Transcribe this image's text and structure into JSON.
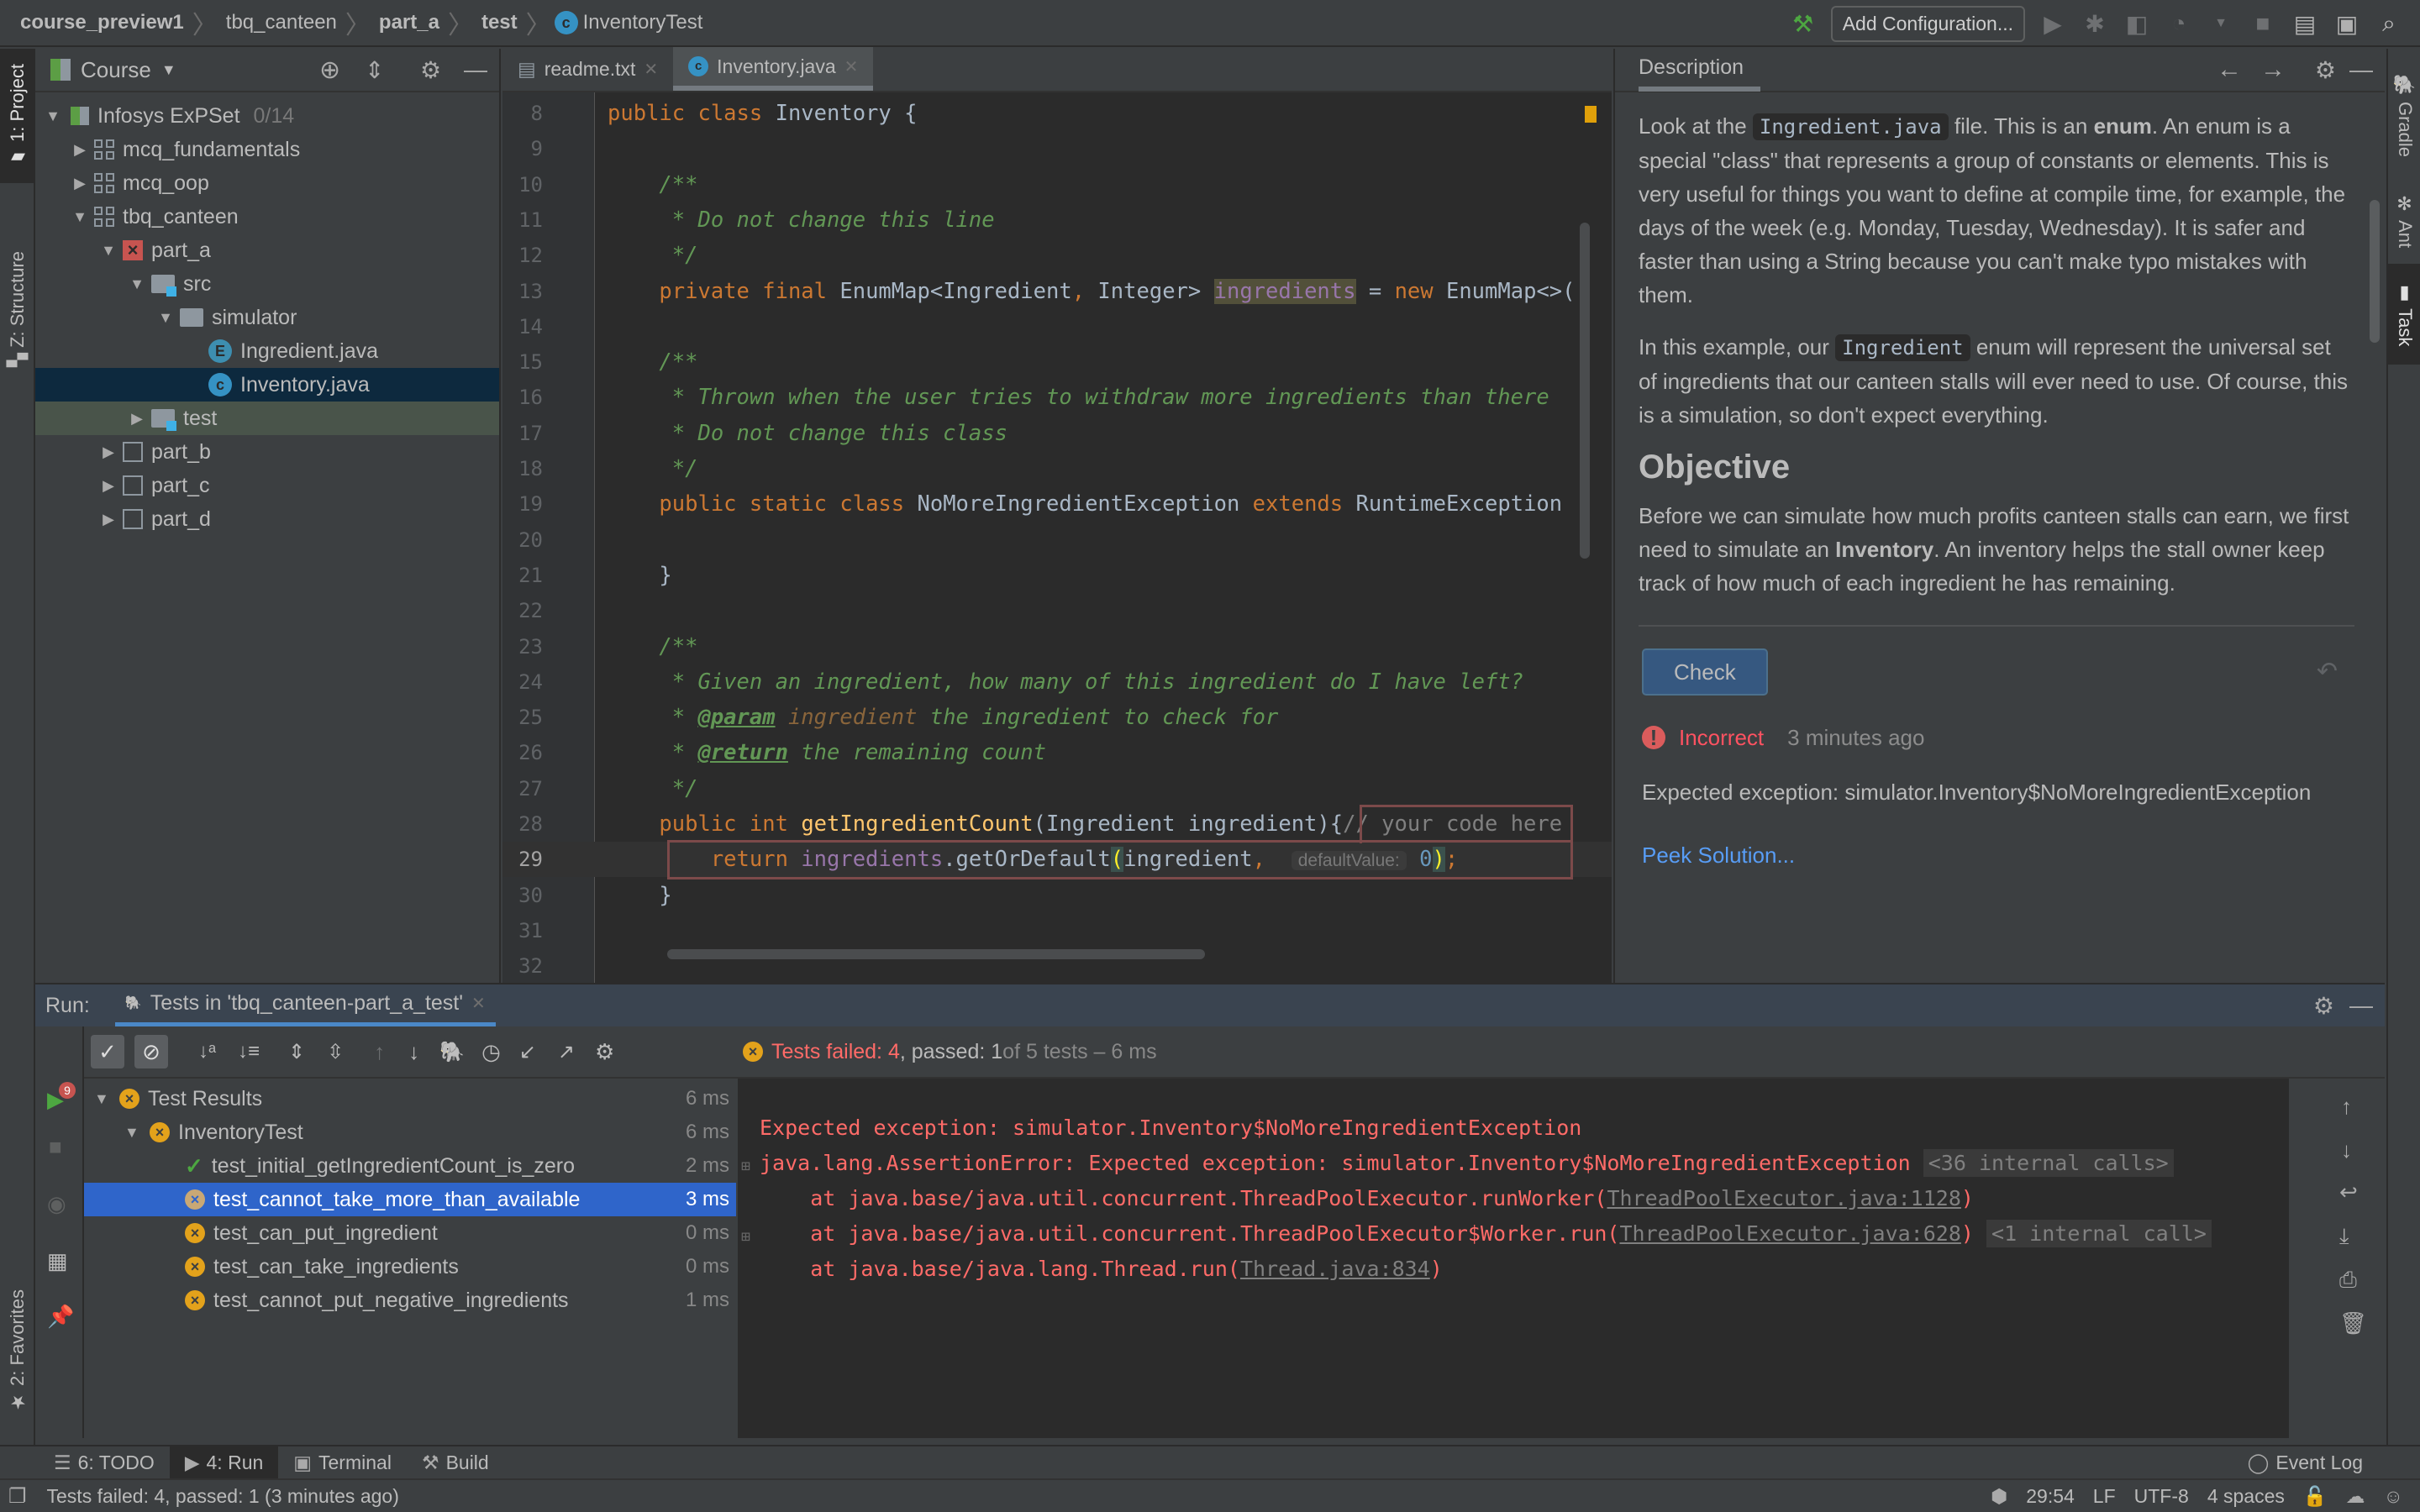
{
  "navbar": {
    "breadcrumbs": [
      "course_preview1",
      "tbq_canteen",
      "part_a",
      "test",
      "InventoryTest"
    ],
    "add_configuration": "Add Configuration..."
  },
  "left_strip": {
    "project": "1: Project",
    "structure": "Z: Structure",
    "favorites": "2: Favorites"
  },
  "right_strip": {
    "gradle": "Gradle",
    "ant": "Ant",
    "task": "Task"
  },
  "project_panel": {
    "title": "Course",
    "tree": [
      {
        "label": "Infosys ExPSet",
        "progress": "0/14",
        "level": 0,
        "expanded": true,
        "icon": "course-book"
      },
      {
        "label": "mcq_fundamentals",
        "level": 1,
        "expanded": false,
        "icon": "module-grid"
      },
      {
        "label": "mcq_oop",
        "level": 1,
        "expanded": false,
        "icon": "module-grid"
      },
      {
        "label": "tbq_canteen",
        "level": 1,
        "expanded": true,
        "icon": "module-grid"
      },
      {
        "label": "part_a",
        "level": 2,
        "expanded": true,
        "icon": "task-failed"
      },
      {
        "label": "src",
        "level": 3,
        "expanded": true,
        "icon": "source-folder"
      },
      {
        "label": "simulator",
        "level": 4,
        "expanded": true,
        "icon": "package-folder"
      },
      {
        "label": "Ingredient.java",
        "level": 5,
        "icon": "enum-file"
      },
      {
        "label": "Inventory.java",
        "level": 5,
        "icon": "class-file",
        "selected": true
      },
      {
        "label": "test",
        "level": 3,
        "expanded": false,
        "icon": "test-folder",
        "highlighted": true
      },
      {
        "label": "part_b",
        "level": 2,
        "expanded": false,
        "icon": "task-unchecked"
      },
      {
        "label": "part_c",
        "level": 2,
        "expanded": false,
        "icon": "task-unchecked"
      },
      {
        "label": "part_d",
        "level": 2,
        "expanded": false,
        "icon": "task-unchecked"
      }
    ]
  },
  "editor": {
    "tabs": [
      {
        "label": "readme.txt",
        "active": false
      },
      {
        "label": "Inventory.java",
        "active": true
      }
    ],
    "current_line": 29,
    "lines": [
      {
        "n": 8,
        "text": "public class Inventory {"
      },
      {
        "n": 9,
        "text": ""
      },
      {
        "n": 10,
        "text": "    /**"
      },
      {
        "n": 11,
        "text": "     * Do not change this line"
      },
      {
        "n": 12,
        "text": "     */"
      },
      {
        "n": 13,
        "text": "    private final EnumMap<Ingredient, Integer> ingredients = new EnumMap<>("
      },
      {
        "n": 14,
        "text": ""
      },
      {
        "n": 15,
        "text": "    /**"
      },
      {
        "n": 16,
        "text": "     * Thrown when the user tries to withdraw more ingredients than there"
      },
      {
        "n": 17,
        "text": "     * Do not change this class"
      },
      {
        "n": 18,
        "text": "     */"
      },
      {
        "n": 19,
        "text": "    public static class NoMoreIngredientException extends RuntimeException"
      },
      {
        "n": 20,
        "text": ""
      },
      {
        "n": 21,
        "text": "    }"
      },
      {
        "n": 22,
        "text": ""
      },
      {
        "n": 23,
        "text": "    /**"
      },
      {
        "n": 24,
        "text": "     * Given an ingredient, how many of this ingredient do I have left?"
      },
      {
        "n": 25,
        "text": "     * @param ingredient the ingredient to check for"
      },
      {
        "n": 26,
        "text": "     * @return the remaining count"
      },
      {
        "n": 27,
        "text": "     */"
      },
      {
        "n": 28,
        "text": "    public int getIngredientCount(Ingredient ingredient){// your code here"
      },
      {
        "n": 29,
        "text": "        return ingredients.getOrDefault(ingredient,  defaultValue: 0);"
      },
      {
        "n": 30,
        "text": "    }"
      },
      {
        "n": 31,
        "text": ""
      },
      {
        "n": 32,
        "text": ""
      }
    ],
    "tokens": {
      "l8": [
        "public",
        "class",
        "Inventory {"
      ],
      "l10": "/**",
      "l11": "* Do not change this line",
      "l12": "*/",
      "l13": [
        "private",
        "final",
        "EnumMap<Ingredient",
        ",",
        " Integer> ",
        "ingredients",
        " = ",
        "new",
        " EnumMap<>("
      ],
      "l15": "/**",
      "l16": "* Thrown when the user tries to withdraw more ingredients than there",
      "l17": "* Do not change this class",
      "l18": "*/",
      "l19": [
        "public",
        "static",
        "class",
        "NoMoreIngredientException",
        "extends",
        "RuntimeException"
      ],
      "l21": "}",
      "l23": "/**",
      "l24": "* Given an ingredient, how many of this ingredient do I have left?",
      "l25": [
        "* ",
        "@param",
        "ingredient",
        "the ingredient to check for"
      ],
      "l26": [
        "* ",
        "@return",
        "the remaining count"
      ],
      "l27": "*/",
      "l28": [
        "public",
        "int",
        "getIngredientCount",
        "(Ingredient ingredient){",
        "// your code here"
      ],
      "l29": [
        "return",
        "ingredients",
        ".getOrDefault",
        "(",
        "ingredient",
        ",",
        "defaultValue:",
        "0",
        ")",
        ";"
      ],
      "l30": "}"
    }
  },
  "description": {
    "tab": "Description",
    "p1_parts": [
      "Look at the ",
      "Ingredient.java",
      " file. This is an ",
      "enum",
      ". An enum is a special \"class\" that represents a group of constants or elements. This is very useful for things you want to define at compile time, for example, the days of the week (e.g. Monday, Tuesday, Wednesday). It is safer and faster than using a String because you can't make typo mistakes with them."
    ],
    "p2_parts": [
      "In this example, our ",
      "Ingredient",
      " enum will represent the universal set of ingredients that our canteen stalls will ever need to use. Of course, this is a simulation, so don't expect everything."
    ],
    "objective_heading": "Objective",
    "p3_parts": [
      "Before we can simulate how much profits canteen stalls can earn, we first need to simulate an ",
      "Inventory",
      ". An inventory helps the stall owner keep track of how much of each ingredient he has remaining."
    ],
    "check_button": "Check",
    "result_status": "Incorrect",
    "result_time": "3 minutes ago",
    "result_message": "Expected exception: simulator.Inventory$NoMoreIngredientException",
    "peek_solution": "Peek Solution..."
  },
  "run_panel": {
    "label": "Run:",
    "tab": "Tests in 'tbq_canteen-part_a_test'",
    "rerun_badge": "9",
    "summary": {
      "failed_label": "Tests failed: ",
      "failed": "4",
      "passed_label": ", passed: ",
      "passed": "1",
      "rest": " of 5 tests – 6 ms"
    },
    "tests": [
      {
        "name": "Test Results",
        "duration": "6 ms",
        "status": "failed",
        "level": 0
      },
      {
        "name": "InventoryTest",
        "duration": "6 ms",
        "status": "failed",
        "level": 1
      },
      {
        "name": "test_initial_getIngredientCount_is_zero",
        "duration": "2 ms",
        "status": "passed",
        "level": 2
      },
      {
        "name": "test_cannot_take_more_than_available",
        "duration": "3 ms",
        "status": "failed",
        "level": 2,
        "selected": true
      },
      {
        "name": "test_can_put_ingredient",
        "duration": "0 ms",
        "status": "failed",
        "level": 2
      },
      {
        "name": "test_can_take_ingredients",
        "duration": "0 ms",
        "status": "failed",
        "level": 2
      },
      {
        "name": "test_cannot_put_negative_ingredients",
        "duration": "1 ms",
        "status": "failed",
        "level": 2
      }
    ],
    "console": {
      "line1": "Expected exception: simulator.Inventory$NoMoreIngredientException",
      "line2": "java.lang.AssertionError: Expected exception: simulator.Inventory$NoMoreIngredientException",
      "line2_fold": "<36 internal calls>",
      "line3_pre": "    at java.base/java.util.concurrent.ThreadPoolExecutor.runWorker(",
      "line3_link": "ThreadPoolExecutor.java:1128",
      "line3_post": ")",
      "line4_pre": "    at java.base/java.util.concurrent.ThreadPoolExecutor$Worker.run(",
      "line4_link": "ThreadPoolExecutor.java:628",
      "line4_post": ")",
      "line4_fold": "<1 internal call>",
      "line5_pre": "    at java.base/java.lang.Thread.run(",
      "line5_link": "Thread.java:834",
      "line5_post": ")"
    }
  },
  "bottom_tabs": [
    {
      "label": "6: TODO",
      "active": false,
      "icon": "list"
    },
    {
      "label": "4: Run",
      "active": true,
      "icon": "run"
    },
    {
      "label": "Terminal",
      "active": false,
      "icon": "terminal"
    },
    {
      "label": "Build",
      "active": false,
      "icon": "hammer"
    }
  ],
  "event_log": "Event Log",
  "status_bar": {
    "message": "Tests failed: 4, passed: 1 (3 minutes ago)",
    "position": "29:54",
    "line_sep": "LF",
    "encoding": "UTF-8",
    "indent": "4 spaces"
  },
  "colors": {
    "accent_blue": "#2f65ca",
    "error_red": "#ff6b68",
    "fail_orange": "#e3a21b",
    "pass_green": "#4da741",
    "link_blue": "#589df6"
  }
}
